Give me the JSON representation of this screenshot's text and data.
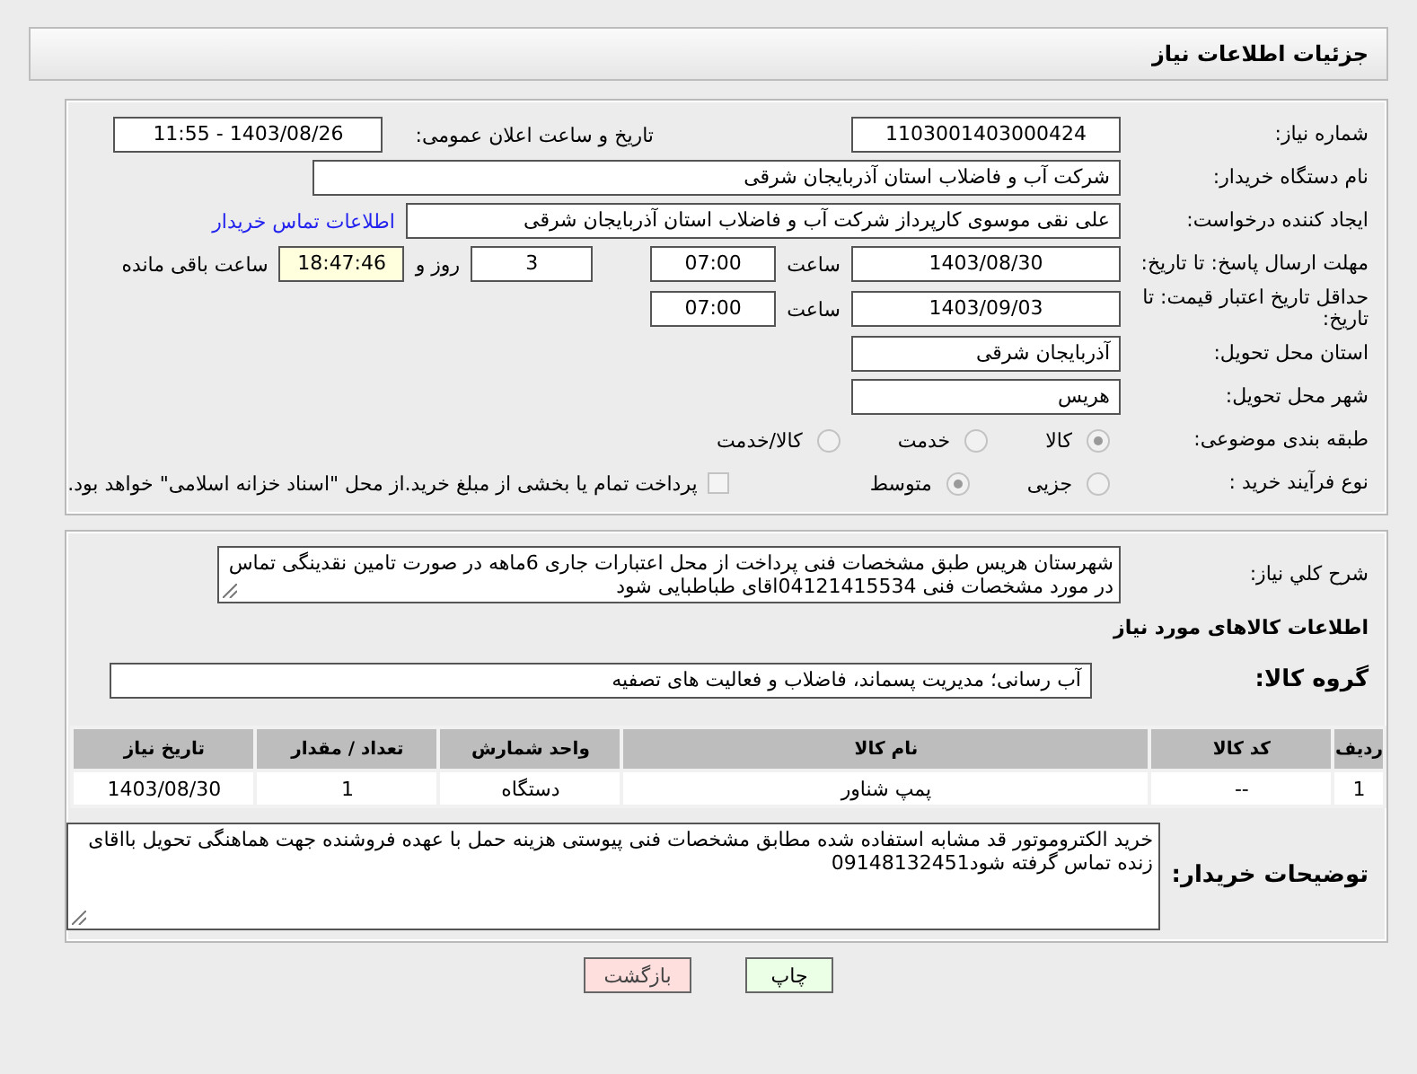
{
  "title": "جزئیات اطلاعات نیاز",
  "need_number": {
    "label": "شماره نیاز:",
    "value": "1103001403000424"
  },
  "announce": {
    "label": "تاریخ و ساعت اعلان عمومی:",
    "value": "1403/08/26 - 11:55"
  },
  "buyer": {
    "label": "نام دستگاه خریدار:",
    "value": "شرکت آب و فاضلاب استان آذربایجان شرقی"
  },
  "requester": {
    "label": "ایجاد کننده درخواست:",
    "value": "علی نقی موسوی کارپرداز شرکت آب و فاضلاب استان آذربایجان شرقی",
    "link": "اطلاعات تماس خریدار"
  },
  "deadline": {
    "label": "مهلت ارسال پاسخ: تا تاریخ:",
    "date": "1403/08/30",
    "time_label": "ساعت",
    "time": "07:00",
    "days": "3",
    "days_label": "روز و",
    "remaining": "18:47:46",
    "remaining_label": "ساعت باقی مانده"
  },
  "validity": {
    "label": "حداقل تاریخ اعتبار قیمت: تا تاریخ:",
    "date": "1403/09/03",
    "time_label": "ساعت",
    "time": "07:00"
  },
  "province": {
    "label": "استان محل تحویل:",
    "value": "آذربایجان شرقی"
  },
  "city": {
    "label": "شهر محل تحویل:",
    "value": "هریس"
  },
  "category": {
    "label": "طبقه بندی موضوعی:",
    "options": [
      {
        "label": "کالا",
        "selected": true
      },
      {
        "label": "خدمت",
        "selected": false
      },
      {
        "label": "کالا/خدمت",
        "selected": false
      }
    ]
  },
  "process": {
    "label": "نوع فرآیند خرید :",
    "options": [
      {
        "label": "جزیی",
        "selected": false
      },
      {
        "label": "متوسط",
        "selected": true
      }
    ],
    "payment": {
      "checked": false,
      "label": "پرداخت تمام یا بخشی از مبلغ خرید.از محل \"اسناد خزانه اسلامی\" خواهد بود."
    }
  },
  "description": {
    "label": "شرح کلي نياز:",
    "value": "شهرستان هریس طبق مشخصات فنی پرداخت از محل اعتبارات جاری  6ماهه در صورت تامین نقدینگی تماس در مورد مشخصات فنی 04121415534اقای  طباطبایی  شود"
  },
  "items_heading": "اطلاعات کالاهای مورد نياز",
  "goods_group": {
    "label": "گروه کالا:",
    "value": "آب رسانی؛ مدیریت پسماند، فاضلاب و فعالیت های تصفیه"
  },
  "table": {
    "columns": [
      "ردیف",
      "کد کالا",
      "نام کالا",
      "واحد شمارش",
      "تعداد / مقدار",
      "تاریخ نیاز"
    ],
    "rows": [
      [
        "1",
        "--",
        "پمپ شناور",
        "دستگاه",
        "1",
        "1403/08/30"
      ]
    ]
  },
  "buyer_notes": {
    "label": "توضیحات خریدار:",
    "value": "خرید الکتروموتور  قد مشابه استفاده شده مطابق مشخصات فنی پیوستی  هزینه حمل با عهده فروشنده جهت هماهنگی تحویل بااقای زنده تماس گرفته شود09148132451"
  },
  "buttons": [
    {
      "label": "چاپ",
      "kind": "print"
    },
    {
      "label": "بازگشت",
      "kind": "back"
    }
  ]
}
